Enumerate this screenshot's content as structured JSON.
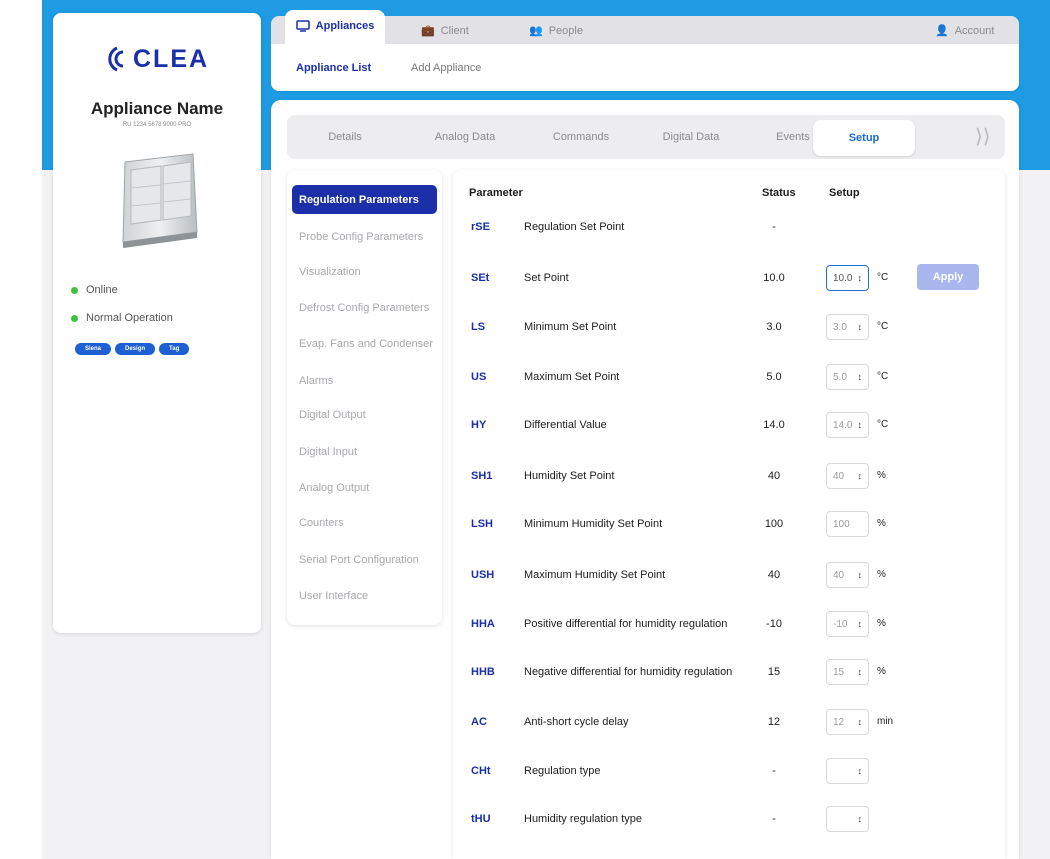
{
  "brand": {
    "logo_text": "CLEA"
  },
  "appliance": {
    "name": "Appliance Name",
    "serial": "RU 1234 5678 9000 PRO",
    "status": [
      "Online",
      "Normal Operation"
    ],
    "tags": [
      "Siena",
      "Design",
      "Tag"
    ]
  },
  "topnav": {
    "appliances": "Appliances",
    "client": "Client",
    "people": "People",
    "account": "Account"
  },
  "subnav": {
    "list": "Appliance List",
    "add": "Add Appliance"
  },
  "tabs": [
    "Details",
    "Analog Data",
    "Commands",
    "Digital Data",
    "Events",
    "Setup"
  ],
  "sidebar": [
    "Regulation Parameters",
    "Probe Config Parameters",
    "Visualization",
    "Defrost Config Parameters",
    "Evap. Fans and Condenser",
    "Alarms",
    "Digital Output",
    "Digital Input",
    "Analog Output",
    "Counters",
    "Serial Port Configuration",
    "User Interface"
  ],
  "table": {
    "headers": {
      "parameter": "Parameter",
      "status": "Status",
      "setup": "Setup"
    },
    "apply_label": "Apply",
    "rows": [
      {
        "code": "rSE",
        "name": "Regulation Set Point",
        "status": "-",
        "setup": "",
        "unit": ""
      },
      {
        "code": "SEt",
        "name": "Set Point",
        "status": "10.0",
        "setup": "10.0",
        "unit": "°C"
      },
      {
        "code": "LS",
        "name": "Minimum Set Point",
        "status": "3.0",
        "setup": "3.0",
        "unit": "°C"
      },
      {
        "code": "US",
        "name": "Maximum Set Point",
        "status": "5.0",
        "setup": "5.0",
        "unit": "°C"
      },
      {
        "code": "HY",
        "name": "Differential Value",
        "status": "14.0",
        "setup": "14.0",
        "unit": "°C"
      },
      {
        "code": "SH1",
        "name": "Humidity Set Point",
        "status": "40",
        "setup": "40",
        "unit": "%"
      },
      {
        "code": "LSH",
        "name": "Minimum Humidity Set Point",
        "status": "100",
        "setup": "100",
        "unit": "%"
      },
      {
        "code": "USH",
        "name": "Maximum Humidity Set Point",
        "status": "40",
        "setup": "40",
        "unit": "%"
      },
      {
        "code": "HHA",
        "name": "Positive differential for humidity regulation",
        "status": "-10",
        "setup": "-10",
        "unit": "%"
      },
      {
        "code": "HHB",
        "name": "Negative differential for humidity regulation",
        "status": "15",
        "setup": "15",
        "unit": "%"
      },
      {
        "code": "AC",
        "name": "Anti-short cycle delay",
        "status": "12",
        "setup": "12",
        "unit": "min"
      },
      {
        "code": "CHt",
        "name": "Regulation type",
        "status": "-",
        "setup": "",
        "unit": ""
      },
      {
        "code": "tHU",
        "name": "Humidity regulation type",
        "status": "-",
        "setup": "",
        "unit": ""
      }
    ]
  },
  "colors": {
    "brand_blue": "#1e9be3",
    "accent": "#1a2fa8",
    "online": "#3cc23c",
    "apply_disabled": "#a9b7ee"
  }
}
